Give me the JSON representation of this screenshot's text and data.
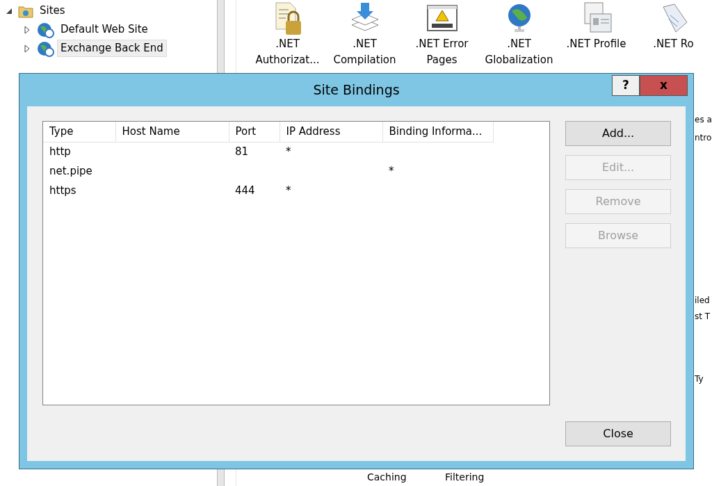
{
  "tree": [
    {
      "label": "Sites",
      "expanded": true,
      "selected": false,
      "children": [
        {
          "label": "Default Web Site",
          "expanded": false,
          "selected": false
        },
        {
          "label": "Exchange Back End",
          "expanded": false,
          "selected": true
        }
      ]
    }
  ],
  "features": [
    {
      "lines": [
        ".NET",
        "Authorizat..."
      ]
    },
    {
      "lines": [
        ".NET",
        "Compilation"
      ]
    },
    {
      "lines": [
        ".NET Error",
        "Pages"
      ]
    },
    {
      "lines": [
        ".NET",
        "Globalization"
      ]
    },
    {
      "lines": [
        ".NET Profile"
      ]
    },
    {
      "lines": [
        ".NET Ro"
      ]
    }
  ],
  "partial_labels": [
    "es a",
    "ntro",
    "iled",
    "st T",
    "Ty"
  ],
  "bottom_labels": [
    "Caching",
    "Filtering"
  ],
  "dialog": {
    "title": "Site Bindings",
    "help_button": "?",
    "close_button": "x",
    "columns": [
      "Type",
      "Host Name",
      "Port",
      "IP Address",
      "Binding Informa..."
    ],
    "rows": [
      [
        "http",
        "",
        "81",
        "*",
        ""
      ],
      [
        "net.pipe",
        "",
        "",
        "",
        "*"
      ],
      [
        "https",
        "",
        "444",
        "*",
        ""
      ]
    ],
    "buttons": [
      {
        "label": "Add...",
        "disabled": false
      },
      {
        "label": "Edit...",
        "disabled": true
      },
      {
        "label": "Remove",
        "disabled": true
      },
      {
        "label": "Browse",
        "disabled": true
      }
    ],
    "close": "Close"
  }
}
